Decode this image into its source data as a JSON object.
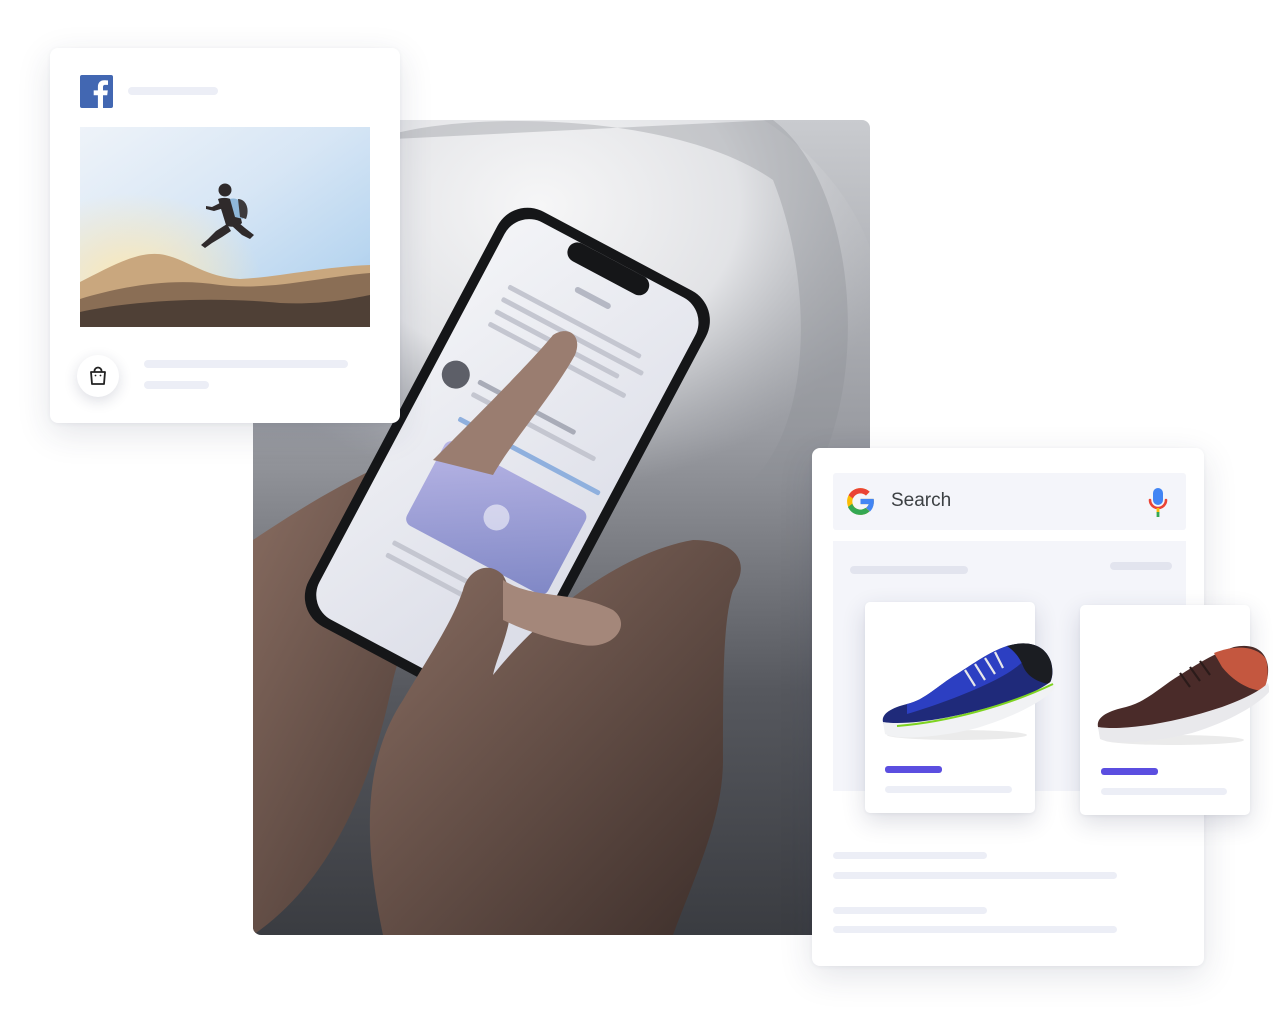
{
  "facebook_post": {
    "logo_icon": "facebook-logo-icon",
    "photo": "person-jumping-over-desert-hills",
    "shop_icon": "shopping-bag-icon"
  },
  "hero_photo": {
    "subject": "hands-holding-smartphone-by-airplane-window"
  },
  "google_search": {
    "logo_icon": "google-g-icon",
    "search_label": "Search",
    "voice_icon": "microphone-icon",
    "products": [
      {
        "icon": "blue-running-shoe-image"
      },
      {
        "icon": "brown-running-shoe-image"
      }
    ]
  },
  "colors": {
    "accent": "#5b4ee0",
    "facebook_blue": "#4267b2",
    "google_blue": "#4285f4",
    "google_red": "#ea4335",
    "google_yellow": "#fbbc05",
    "google_green": "#34a853",
    "placeholder_bar": "#eceef6",
    "panel_bg": "#f4f5fa"
  }
}
